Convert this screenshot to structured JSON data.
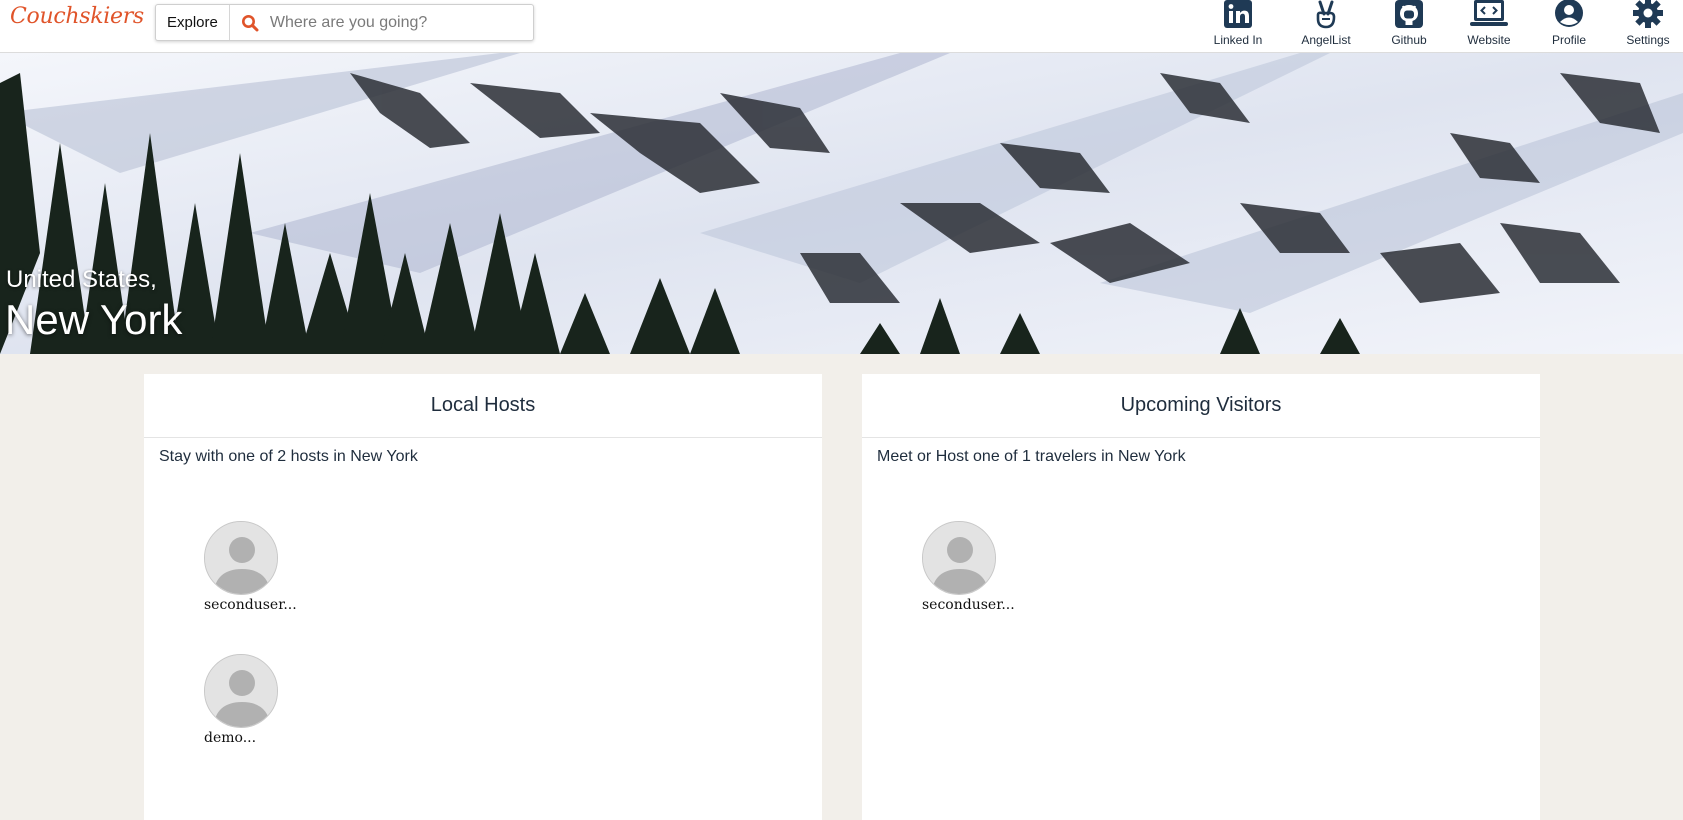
{
  "brand": {
    "name": "Couchskiers",
    "color": "#e0542a"
  },
  "search": {
    "explore_label": "Explore",
    "placeholder": "Where are you going?"
  },
  "nav": [
    {
      "label": "Linked In",
      "icon": "linkedin-icon"
    },
    {
      "label": "AngelList",
      "icon": "angellist-icon"
    },
    {
      "label": "Github",
      "icon": "github-icon"
    },
    {
      "label": "Website",
      "icon": "laptop-code-icon"
    },
    {
      "label": "Profile",
      "icon": "user-circle-icon"
    },
    {
      "label": "Settings",
      "icon": "gear-icon"
    }
  ],
  "hero": {
    "country": "United States,",
    "city": "New York"
  },
  "hosts": {
    "title": "Local Hosts",
    "subtitle": "Stay with one of 2 hosts in New York",
    "people": [
      {
        "name": "seconduser..."
      },
      {
        "name": "demo..."
      }
    ]
  },
  "visitors": {
    "title": "Upcoming Visitors",
    "subtitle": "Meet or Host one of 1 travelers in New York",
    "people": [
      {
        "name": "seconduser..."
      }
    ]
  }
}
